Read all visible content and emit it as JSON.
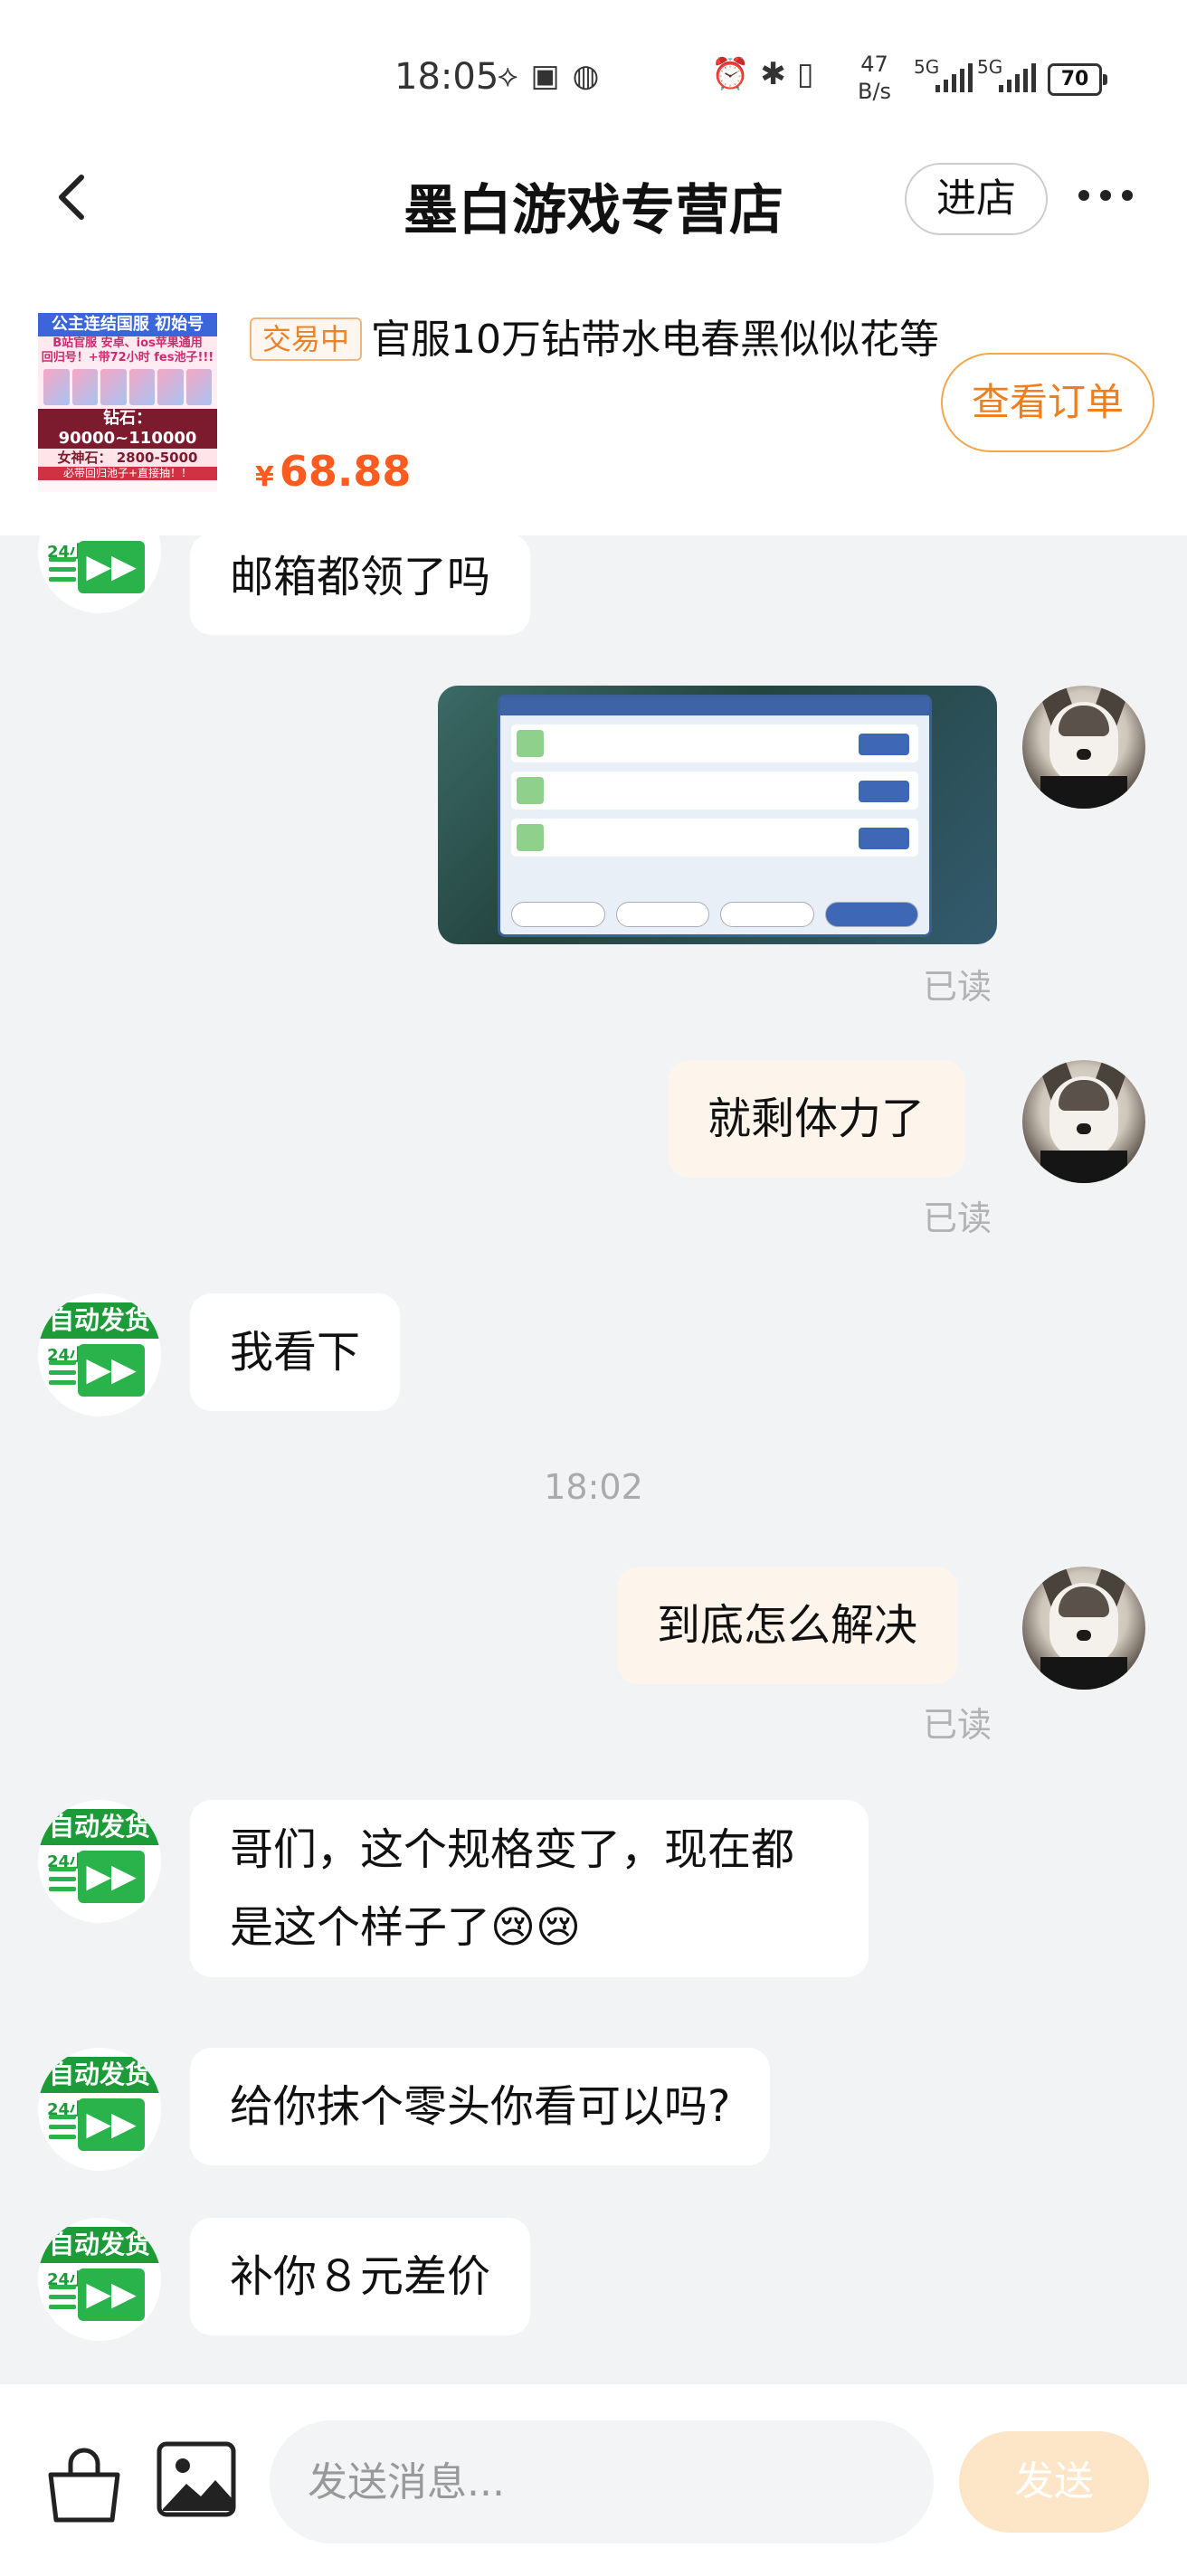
{
  "status_bar": {
    "time": "18:05",
    "net_speed_top": "47",
    "net_speed_bottom": "B/s",
    "sim1": "5G",
    "sim2": "5G",
    "battery": "70"
  },
  "header": {
    "title": "墨白游戏专营店",
    "store_button": "进店"
  },
  "product": {
    "thumb_lines": [
      "公主连结国服 初始号",
      "B站官服 安卓、ios苹果通用",
      "回归号！+带72小时 fes池子!!!",
      "钻石：  90000~110000",
      "女神石：  2800-5000",
      "必带回归池子+直接抽！！"
    ],
    "status_badge": "交易中",
    "title": "官服10万钻带水电春黑似似花等",
    "currency": "¥",
    "price": "68.88",
    "order_button": "查看订单"
  },
  "chat": {
    "avatar_shop_banner": "自动发货",
    "avatar_shop_label": "24小时",
    "messages": [
      {
        "text": "邮箱都领了吗"
      },
      {
        "read": "已读"
      },
      {
        "text": "就剩体力了",
        "read": "已读"
      },
      {
        "text": "我看下"
      },
      {
        "time": "18:02"
      },
      {
        "text": "到底怎么解决",
        "read": "已读"
      },
      {
        "text": "哥们，这个规格变了，现在都是这个样子了😢😢"
      },
      {
        "text": "给你抹个零头你看可以吗?"
      },
      {
        "text": "补你８元差价"
      }
    ]
  },
  "composer": {
    "placeholder": "发送消息...",
    "send_label": "发送"
  }
}
